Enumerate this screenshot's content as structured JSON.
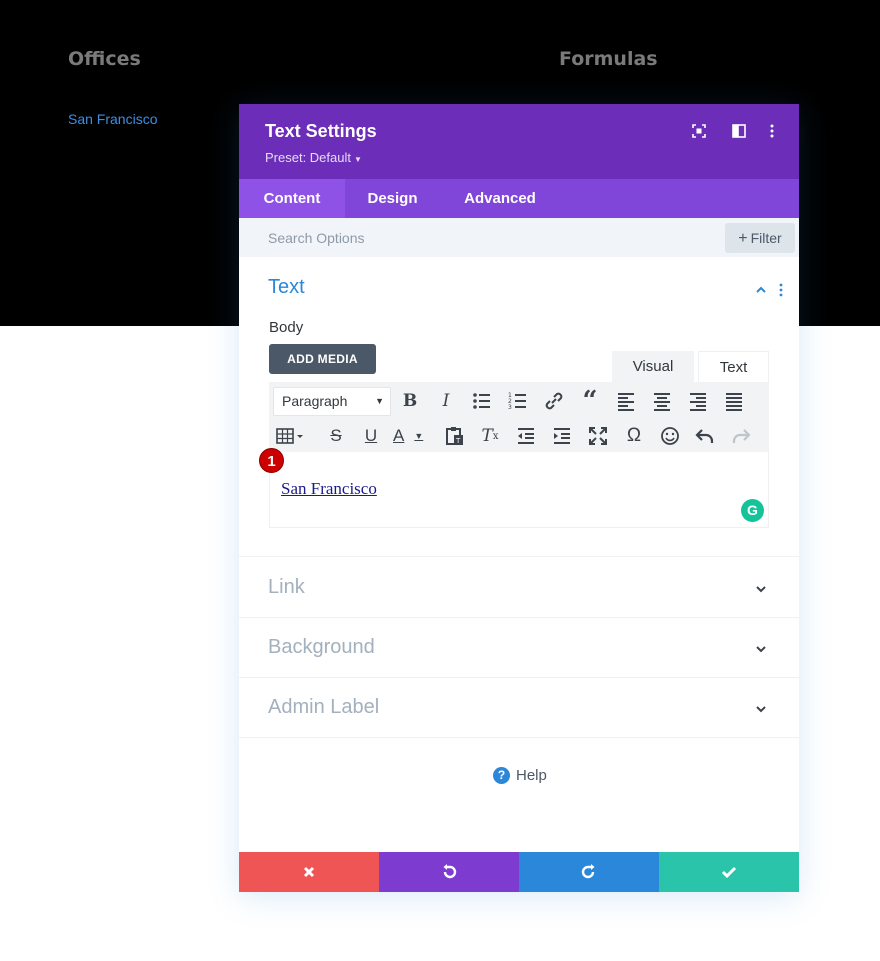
{
  "background": {
    "headings": [
      "Offices",
      "Formulas"
    ],
    "link_text": "San Francisco"
  },
  "modal": {
    "title": "Text Settings",
    "preset": "Preset: Default",
    "header_icons": [
      "fullscreen-icon",
      "split-view-icon",
      "more-vertical-icon"
    ],
    "tabs": [
      {
        "label": "Content",
        "active": true
      },
      {
        "label": "Design",
        "active": false
      },
      {
        "label": "Advanced",
        "active": false
      }
    ],
    "search": {
      "placeholder": "Search Options",
      "filter_label": "Filter"
    },
    "text_section": {
      "title": "Text",
      "body_label": "Body",
      "add_media_label": "ADD MEDIA",
      "editor_tabs": {
        "visual": "Visual",
        "text": "Text"
      },
      "paragraph_select": "Paragraph",
      "toolbar_row1": [
        "bold-icon",
        "italic-icon",
        "bullet-list-icon",
        "numbered-list-icon",
        "link-icon",
        "blockquote-icon",
        "align-left-icon",
        "align-center-icon",
        "align-right-icon",
        "justify-icon"
      ],
      "toolbar_row2": [
        "table-icon",
        "strikethrough-icon",
        "underline-icon",
        "text-color-icon",
        "paste-as-text-icon",
        "clear-formatting-icon",
        "outdent-icon",
        "indent-icon",
        "fullscreen-icon",
        "special-character-icon",
        "emoji-icon",
        "undo-icon",
        "redo-icon"
      ],
      "content_link": "San Francisco",
      "step_badge": "1",
      "grammarly_badge": "G"
    },
    "collapsed_sections": [
      "Link",
      "Background",
      "Admin Label"
    ],
    "help_label": "Help",
    "footer": {
      "buttons": [
        {
          "name": "discard",
          "color": "#ef5555"
        },
        {
          "name": "undo",
          "color": "#7e3bd0"
        },
        {
          "name": "redo",
          "color": "#2b87da"
        },
        {
          "name": "save",
          "color": "#29c4a9"
        }
      ]
    }
  },
  "colors": {
    "header": "#6c2eb9",
    "tabs_bar": "#8045d9",
    "active_tab": "#8f52e6",
    "section_title_active": "#2b87da",
    "section_title_muted": "#a3b0bd"
  }
}
